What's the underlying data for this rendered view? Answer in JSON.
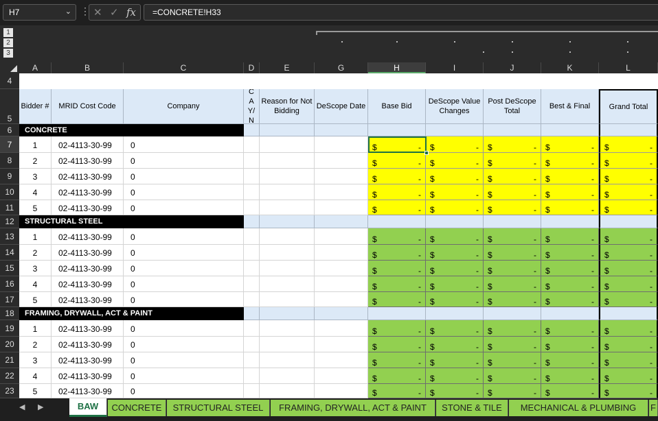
{
  "formula_bar": {
    "name_box": "H7",
    "formula": "=CONCRETE!H33",
    "cancel_glyph": "✕",
    "enter_glyph": "✓",
    "fx_glyph": "fx"
  },
  "outline_levels": [
    "1",
    "2",
    "3"
  ],
  "columns": [
    "A",
    "B",
    "C",
    "D",
    "E",
    "G",
    "H",
    "I",
    "J",
    "K",
    "L"
  ],
  "rows": [
    "4",
    "5",
    "6",
    "7",
    "8",
    "9",
    "10",
    "11",
    "12",
    "13",
    "14",
    "15",
    "16",
    "17",
    "18",
    "19",
    "20",
    "21",
    "22",
    "23"
  ],
  "table_headers": {
    "bidder": "Bidder #",
    "mrid": "MRID Cost Code",
    "company": "Company",
    "ca": "CA Y/ N",
    "reason": "Reason for Not Bidding",
    "descope_date": "DeScope Date",
    "base_bid": "Base Bid",
    "descope_value": "DeScope Value Changes",
    "post_descope": "Post DeScope Total",
    "best_final": "Best & Final",
    "grand_total": "Grand Total"
  },
  "sections": [
    {
      "title": "CONCRETE",
      "fill": "#ffff00",
      "rows": [
        {
          "bidder": "1",
          "code": "02-4113-30-99",
          "company": "0"
        },
        {
          "bidder": "2",
          "code": "02-4113-30-99",
          "company": "0"
        },
        {
          "bidder": "3",
          "code": "02-4113-30-99",
          "company": "0"
        },
        {
          "bidder": "4",
          "code": "02-4113-30-99",
          "company": "0"
        },
        {
          "bidder": "5",
          "code": "02-4113-30-99",
          "company": "0"
        }
      ]
    },
    {
      "title": "STRUCTURAL STEEL",
      "fill": "#92d050",
      "rows": [
        {
          "bidder": "1",
          "code": "02-4113-30-99",
          "company": "0"
        },
        {
          "bidder": "2",
          "code": "02-4113-30-99",
          "company": "0"
        },
        {
          "bidder": "3",
          "code": "02-4113-30-99",
          "company": "0"
        },
        {
          "bidder": "4",
          "code": "02-4113-30-99",
          "company": "0"
        },
        {
          "bidder": "5",
          "code": "02-4113-30-99",
          "company": "0"
        }
      ]
    },
    {
      "title": "FRAMING, DRYWALL, ACT & PAINT",
      "fill": "#92d050",
      "rows": [
        {
          "bidder": "1",
          "code": "02-4113-30-99",
          "company": "0"
        },
        {
          "bidder": "2",
          "code": "02-4113-30-99",
          "company": "0"
        },
        {
          "bidder": "3",
          "code": "02-4113-30-99",
          "company": "0"
        },
        {
          "bidder": "4",
          "code": "02-4113-30-99",
          "company": "0"
        },
        {
          "bidder": "5",
          "code": "02-4113-30-99",
          "company": "0"
        }
      ]
    }
  ],
  "money_cell": {
    "symbol": "$",
    "value": "-"
  },
  "sheet_tabs": [
    {
      "label": "BAW",
      "active": true
    },
    {
      "label": "CONCRETE",
      "active": false
    },
    {
      "label": "STRUCTURAL STEEL",
      "active": false
    },
    {
      "label": "FRAMING, DRYWALL, ACT & PAINT",
      "active": false
    },
    {
      "label": "STONE & TILE",
      "active": false
    },
    {
      "label": "MECHANICAL & PLUMBING",
      "active": false
    },
    {
      "label": "F",
      "active": false
    }
  ],
  "nav": {
    "prev": "◀",
    "next": "▶"
  }
}
